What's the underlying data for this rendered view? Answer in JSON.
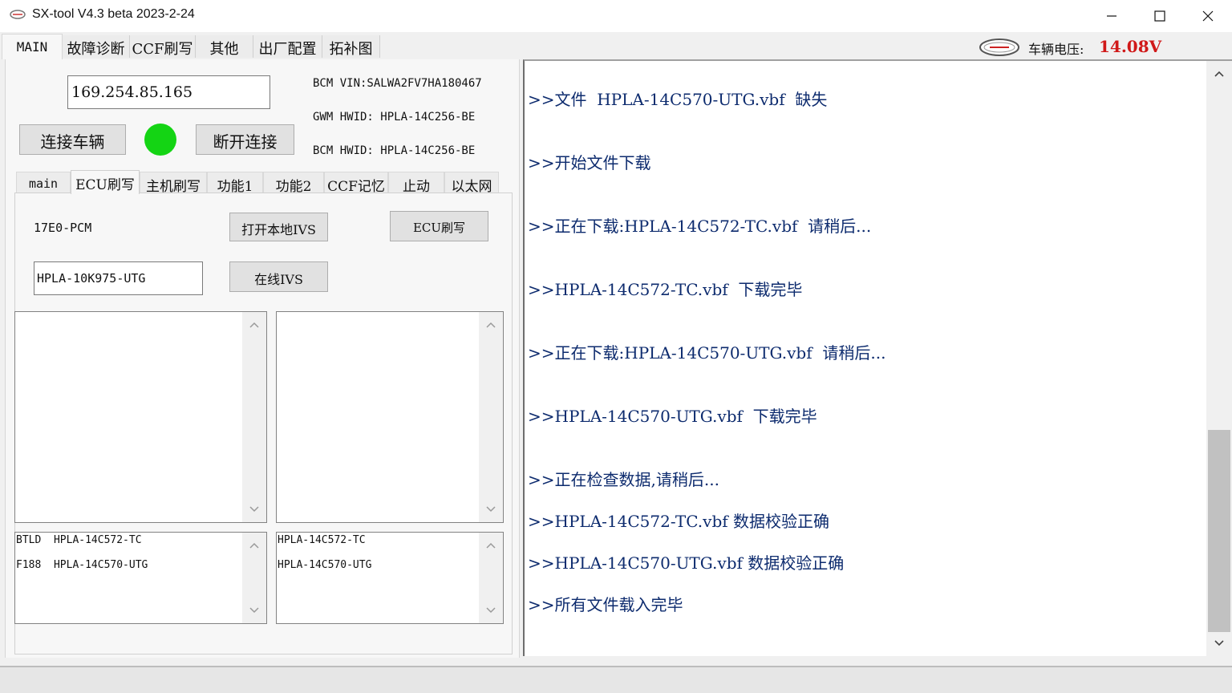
{
  "window": {
    "title": "SX-tool V4.3 beta 2023-2-24",
    "icon": "car-logo-icon"
  },
  "main_tabs": [
    {
      "label": "MAIN",
      "active": true
    },
    {
      "label": "故障诊断"
    },
    {
      "label": "CCF刷写"
    },
    {
      "label": "其他"
    },
    {
      "label": "出厂配置"
    },
    {
      "label": "拓补图"
    }
  ],
  "voltage": {
    "label": "车辆电压:",
    "value": "14.08V",
    "color": "#d01818"
  },
  "connection": {
    "ip": "169.254.85.165",
    "connect_label": "连接车辆",
    "disconnect_label": "断开连接",
    "status_color": "#14d414"
  },
  "info": {
    "bcm_vin": "BCM VIN:SALWA2FV7HA180467",
    "gwm_hwid": "GWM HWID: HPLA-14C256-BE",
    "bcm_hwid": "BCM HWID: HPLA-14C256-BE"
  },
  "sub_tabs": [
    {
      "label": "main"
    },
    {
      "label": "ECU刷写",
      "active": true
    },
    {
      "label": "主机刷写"
    },
    {
      "label": "功能1"
    },
    {
      "label": "功能2"
    },
    {
      "label": "CCF记忆"
    },
    {
      "label": "止动"
    },
    {
      "label": "以太网"
    }
  ],
  "ecu_flash": {
    "module_label": "17E0-PCM",
    "open_local_ivs": "打开本地IVS",
    "ecu_flash_button": "ECU刷写",
    "part_number": "HPLA-10K975-UTG",
    "online_ivs": "在线IVS"
  },
  "lists": {
    "left_bottom": [
      "BTLD  HPLA-14C572-TC",
      "F188  HPLA-14C570-UTG"
    ],
    "right_bottom": [
      "HPLA-14C572-TC",
      "HPLA-14C570-UTG"
    ]
  },
  "log": [
    ">>文件  HPLA-14C570-UTG.vbf  缺失",
    ">>开始文件下载",
    ">>正在下载:HPLA-14C572-TC.vbf  请稍后...",
    ">>HPLA-14C572-TC.vbf  下载完毕",
    ">>正在下载:HPLA-14C570-UTG.vbf  请稍后...",
    ">>HPLA-14C570-UTG.vbf  下载完毕",
    ">>正在检查数据,请稍后...",
    ">>HPLA-14C572-TC.vbf 数据校验正确",
    ">>HPLA-14C570-UTG.vbf 数据校验正确",
    ">>所有文件载入完毕"
  ]
}
